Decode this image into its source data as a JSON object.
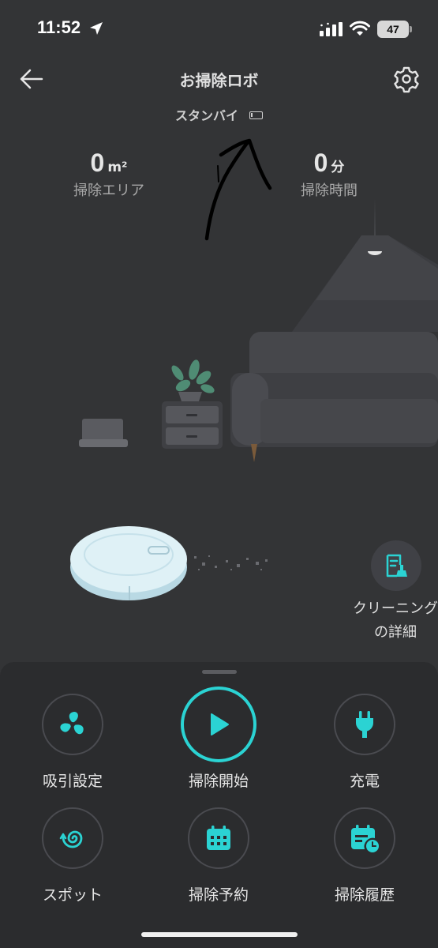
{
  "status_bar": {
    "time": "11:52",
    "battery": "47"
  },
  "header": {
    "title": "お掃除ロボ"
  },
  "robot_status": {
    "text": "スタンバイ"
  },
  "stats": {
    "area": {
      "value": "0",
      "unit": "m²",
      "label": "掃除エリア"
    },
    "time": {
      "value": "0",
      "unit": "分",
      "label": "掃除時間"
    }
  },
  "cleaning_detail": {
    "label": "クリーニングの詳細"
  },
  "controls": [
    {
      "label": "吸引設定",
      "icon": "fan-icon"
    },
    {
      "label": "掃除開始",
      "icon": "play-icon"
    },
    {
      "label": "充電",
      "icon": "plug-icon"
    },
    {
      "label": "スポット",
      "icon": "spiral-icon"
    },
    {
      "label": "掃除予約",
      "icon": "calendar-icon"
    },
    {
      "label": "掃除履歴",
      "icon": "calendar-clock-icon"
    }
  ],
  "colors": {
    "accent": "#2bd3d3",
    "background": "#333436",
    "panel": "#2b2c2e"
  }
}
